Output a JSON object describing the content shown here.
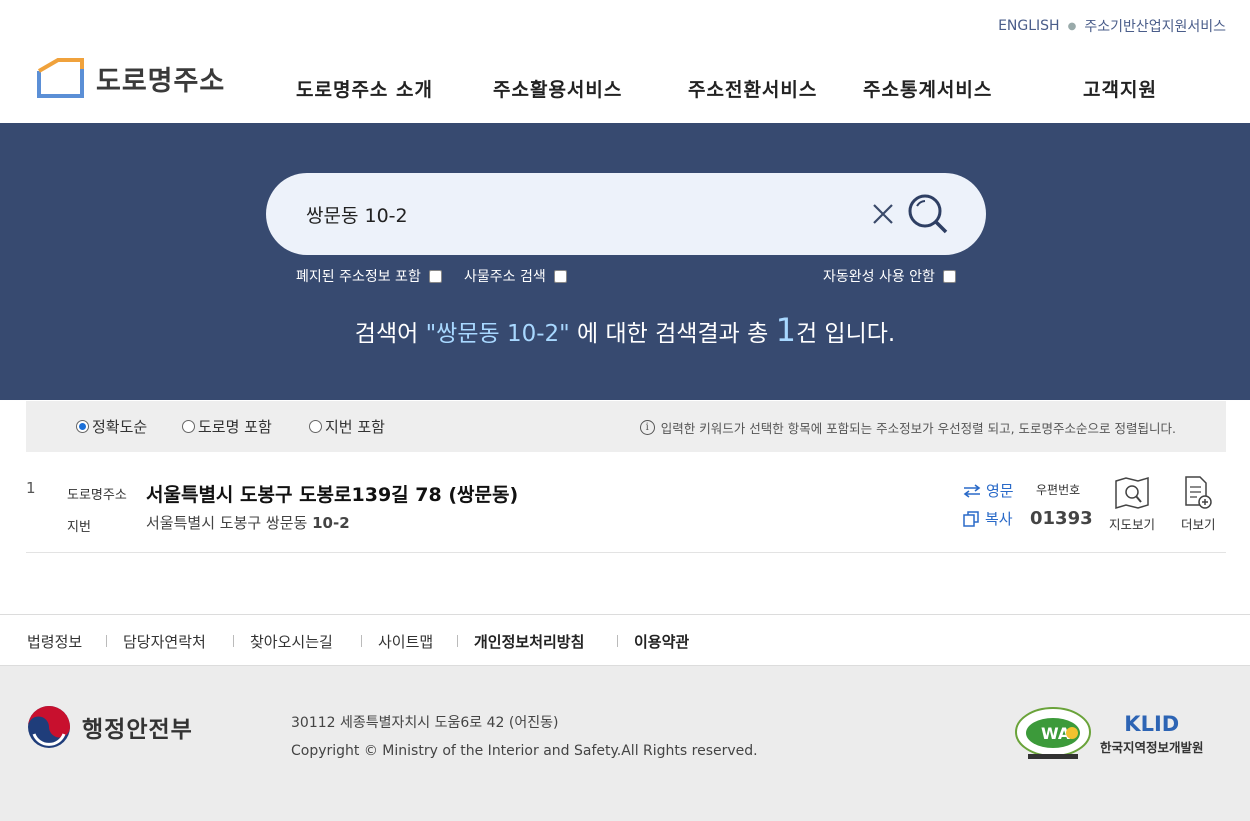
{
  "header": {
    "util_links": [
      "ENGLISH",
      "주소기반산업지원서비스"
    ],
    "logo_text": "도로명주소",
    "nav": [
      "도로명주소 소개",
      "주소활용서비스",
      "주소전환서비스",
      "주소통계서비스",
      "고객지원"
    ]
  },
  "search": {
    "query": "쌍문동 10-2",
    "options_left": [
      "폐지된 주소정보 포함",
      "사물주소 검색"
    ],
    "option_right": "자동완성 사용 안함",
    "result_prefix": "검색어 ",
    "result_keyword": "\"쌍문동 10-2\"",
    "result_mid": " 에 대한 검색결과 총 ",
    "result_count": "1",
    "result_suffix": "건 입니다."
  },
  "filter": {
    "options": [
      "정확도순",
      "도로명 포함",
      "지번 포함"
    ],
    "selected": "정확도순",
    "note": "입력한 키워드가 선택한 항목에 포함되는 주소정보가 우선정렬 되고, 도로명주소순으로 정렬됩니다."
  },
  "results": [
    {
      "no": "1",
      "road_label": "도로명주소",
      "road_address": "서울특별시 도봉구 도봉로139길 78 (쌍문동)",
      "jibun_label": "지번",
      "jibun_prefix": "서울특별시 도봉구 쌍문동 ",
      "jibun_number": "10-2",
      "english_label": "영문",
      "copy_label": "복사",
      "zip_label": "우편번호",
      "zip": "01393",
      "map_label": "지도보기",
      "more_label": "더보기"
    }
  ],
  "footer": {
    "links": [
      "법령정보",
      "담당자연락처",
      "찾아오시는길",
      "사이트맵",
      "개인정보처리방침",
      "이용약관"
    ],
    "ministry": "행정안전부",
    "address": "30112 세종특별자치시 도움6로 42 (어진동)",
    "copyright": "Copyright © Ministry of the Interior and Safety.All Rights reserved.",
    "klid_mark": "KLID",
    "klid_name": "한국지역정보개발원",
    "wa_mark": "WA"
  }
}
